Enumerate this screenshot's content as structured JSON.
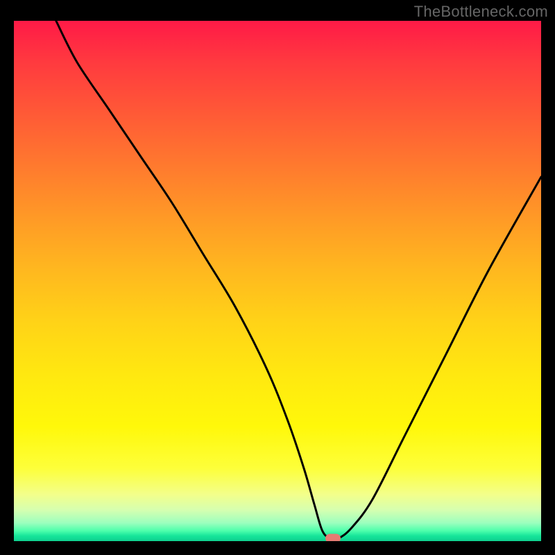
{
  "watermark": "TheBottleneck.com",
  "chart_data": {
    "type": "line",
    "title": "",
    "xlabel": "",
    "ylabel": "",
    "xlim": [
      0,
      100
    ],
    "ylim": [
      0,
      100
    ],
    "grid": false,
    "legend": false,
    "series": [
      {
        "name": "bottleneck-curve",
        "x": [
          8,
          12,
          18,
          24,
          30,
          36,
          42,
          48,
          52,
          55,
          57,
          58.5,
          60,
          61.5,
          64,
          68,
          74,
          82,
          90,
          100
        ],
        "values": [
          100,
          92,
          83,
          74,
          65,
          55,
          45,
          33,
          23,
          14,
          7,
          2,
          0.5,
          0.5,
          2.5,
          8,
          20,
          36,
          52,
          70
        ]
      }
    ],
    "annotations": [
      {
        "name": "optimal-marker",
        "x": 60.5,
        "y": 0.6,
        "shape": "pill",
        "color": "#e57b73"
      }
    ],
    "background": {
      "type": "vertical-gradient",
      "stops": [
        {
          "pct": 0,
          "color": "#ff1a47"
        },
        {
          "pct": 50,
          "color": "#ffd317"
        },
        {
          "pct": 85,
          "color": "#fdff3a"
        },
        {
          "pct": 100,
          "color": "#0fd08f"
        }
      ]
    }
  }
}
